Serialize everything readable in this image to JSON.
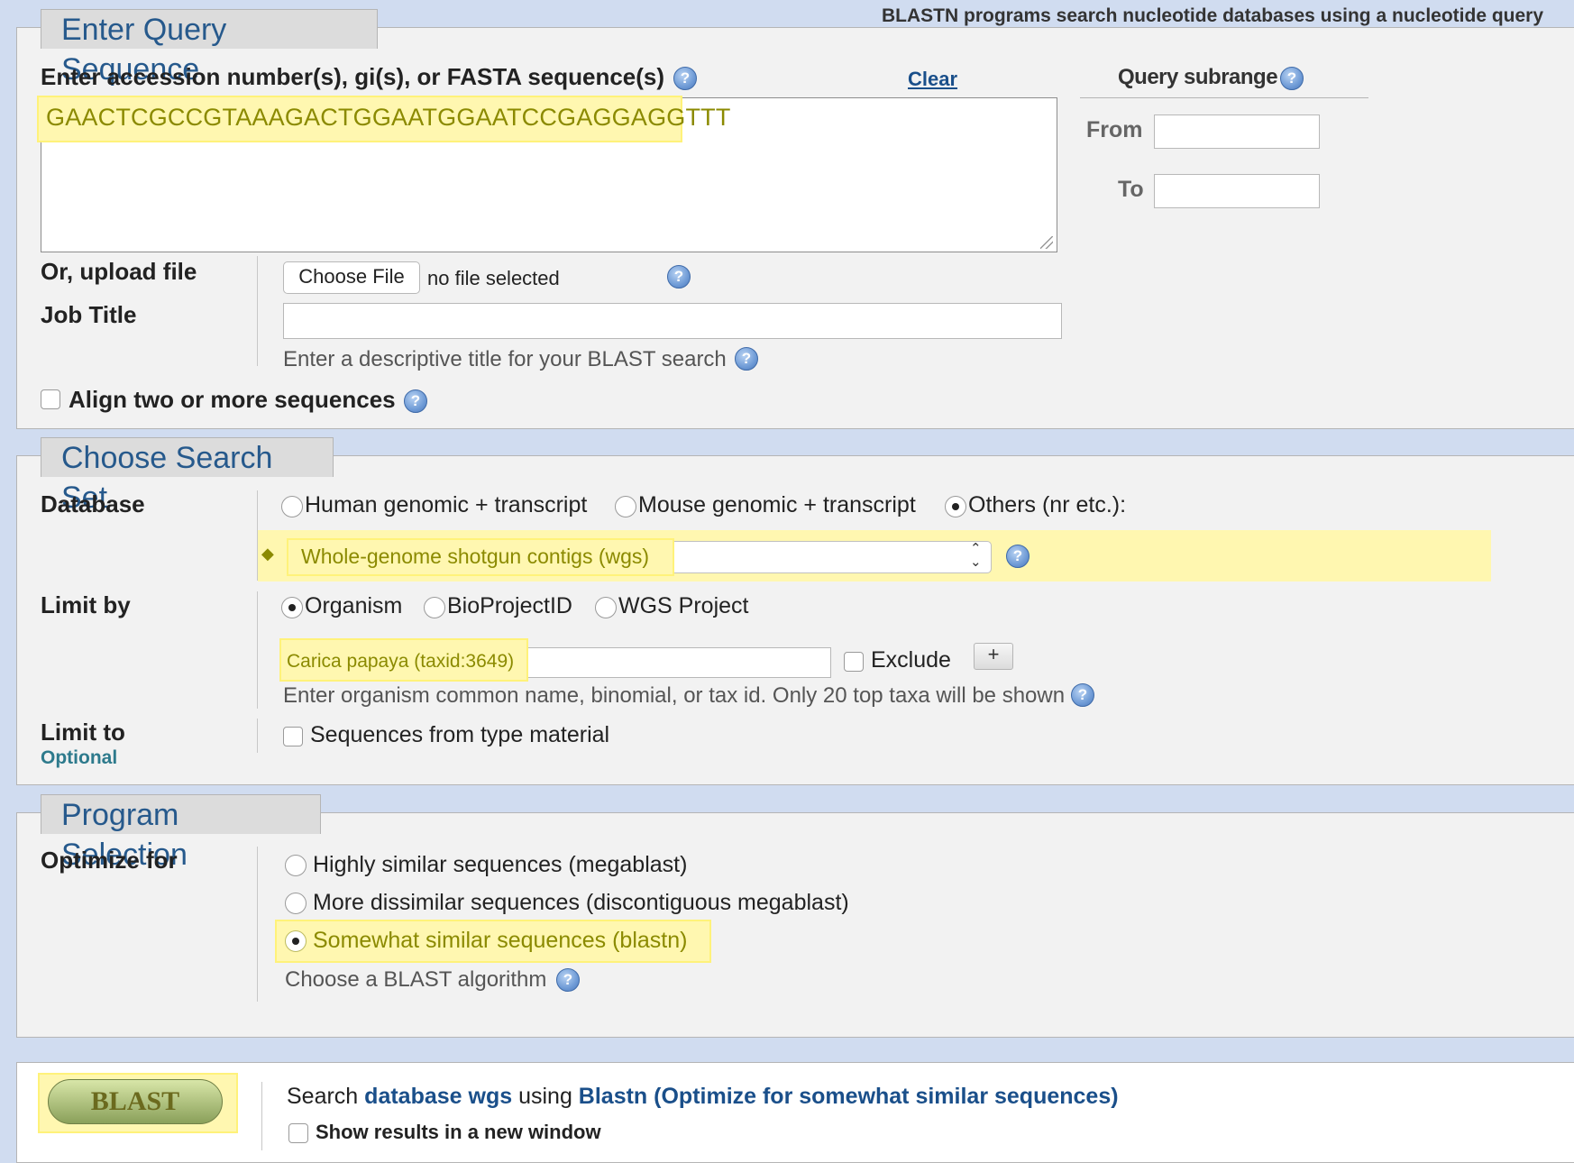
{
  "header_note": "BLASTN programs search nucleotide databases using a nucleotide query",
  "query_section": {
    "title": "Enter Query Sequence",
    "seq_label": "Enter accession number(s), gi(s), or FASTA sequence(s)",
    "clear_link": "Clear",
    "sequence_value": "GAACTCGCCGTAAAGACTGGAATGGAATCCGAGGAGGTTT",
    "subrange_title": "Query subrange",
    "from_label": "From",
    "to_label": "To",
    "upload_label": "Or, upload file",
    "choose_file_button": "Choose File",
    "no_file_text": "no file selected",
    "job_title_label": "Job Title",
    "job_title_hint": "Enter a descriptive title for your BLAST search",
    "align_label": "Align two or more sequences"
  },
  "search_set": {
    "title": "Choose Search Set",
    "database_label": "Database",
    "db_options": [
      "Human genomic + transcript",
      "Mouse genomic + transcript",
      "Others (nr etc.):"
    ],
    "db_selected_index": 2,
    "db_select_value": "Whole-genome shotgun contigs (wgs)",
    "limit_by_label": "Limit by",
    "limit_options": [
      "Organism",
      "BioProjectID",
      "WGS Project"
    ],
    "limit_selected_index": 0,
    "organism_value": "Carica papaya (taxid:3649)",
    "exclude_label": "Exclude",
    "add_button": "+",
    "organism_hint": "Enter organism common name, binomial, or tax id. Only 20 top taxa will be shown",
    "limit_to_label": "Limit to",
    "optional_label": "Optional",
    "type_material_label": "Sequences from type material"
  },
  "program": {
    "title": "Program Selection",
    "optimize_label": "Optimize for",
    "options": [
      "Highly similar sequences (megablast)",
      "More dissimilar sequences (discontiguous megablast)",
      "Somewhat similar sequences (blastn)"
    ],
    "selected_index": 2,
    "algorithm_hint": "Choose a BLAST algorithm"
  },
  "submit": {
    "blast_button": "BLAST",
    "search_prefix": "Search",
    "search_db_link": "database wgs",
    "search_using": "using",
    "search_program_link": "Blastn (Optimize for somewhat similar sequences)",
    "new_window_label": "Show results in a new window"
  },
  "colors": {
    "tab_text": "#26598c",
    "highlight": "#fff7b0",
    "link": "#1a4f8a",
    "page_bg": "#d0dcf0"
  }
}
